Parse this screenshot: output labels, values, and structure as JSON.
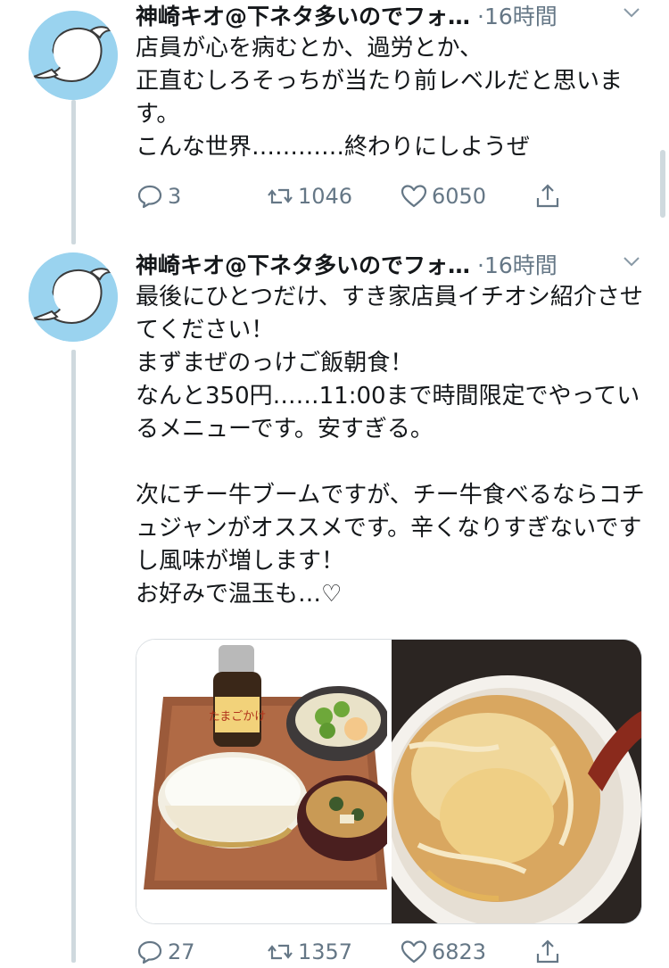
{
  "tweets": [
    {
      "author": "神崎キオ@下ネタ多いのでフォ…",
      "time": "·16時間",
      "text": "店員が心を病むとか、過労とか、\n正直むしろそっちが当たり前レベルだと思います。\nこんな世界…………終わりにしようぜ",
      "replies": "3",
      "retweets": "1046",
      "likes": "6050"
    },
    {
      "author": "神崎キオ@下ネタ多いのでフォ…",
      "time": "·16時間",
      "text": "最後にひとつだけ、すき家店員イチオシ紹介させてください！\nまずまぜのっけご飯朝食！\nなんと350円……11:00まで時間限定でやっているメニューです。安すぎる。\n\n次にチー牛ブームですが、チー牛食べるならコチュジャンがオススメです。辛くなりすぎないですし風味が増します！\nお好みで温玉も…♡",
      "replies": "27",
      "retweets": "1357",
      "likes": "6823"
    }
  ],
  "media": {
    "bottle_label": "たまごかけ"
  },
  "colors": {
    "text": "#14171a",
    "muted": "#657786",
    "thread_line": "#cfd9de",
    "avatar_bg": "#9ad3ef"
  },
  "icons": [
    "reply-icon",
    "retweet-icon",
    "like-icon",
    "share-icon",
    "chevron-down-icon"
  ]
}
